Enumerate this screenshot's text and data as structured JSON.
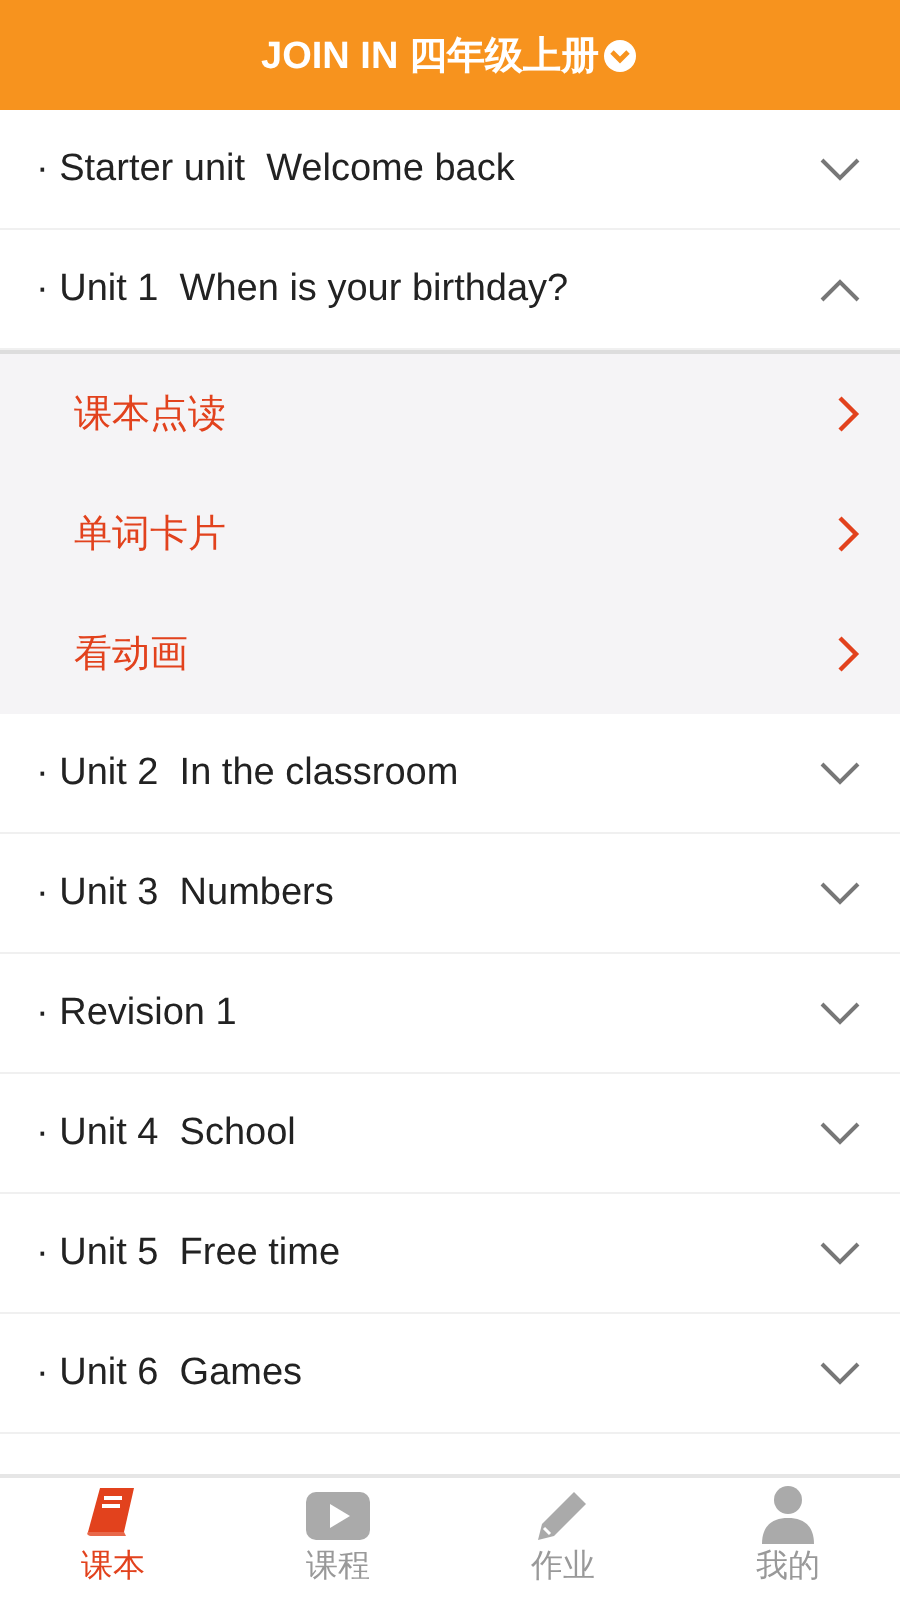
{
  "header": {
    "title": "JOIN IN 四年级上册"
  },
  "units": [
    {
      "title": "· Starter unit  Welcome back",
      "expanded": false
    },
    {
      "title": "· Unit 1  When is your birthday?",
      "expanded": true,
      "children": [
        {
          "label": "课本点读"
        },
        {
          "label": "单词卡片"
        },
        {
          "label": "看动画"
        }
      ]
    },
    {
      "title": "· Unit 2  In the classroom",
      "expanded": false
    },
    {
      "title": "· Unit 3  Numbers",
      "expanded": false
    },
    {
      "title": "· Revision 1",
      "expanded": false
    },
    {
      "title": "· Unit 4  School",
      "expanded": false
    },
    {
      "title": "· Unit 5  Free time",
      "expanded": false
    },
    {
      "title": "· Unit 6  Games",
      "expanded": false
    }
  ],
  "tabs": [
    {
      "label": "课本",
      "kind": "book",
      "selected": true
    },
    {
      "label": "课程",
      "kind": "video",
      "selected": false
    },
    {
      "label": "作业",
      "kind": "pencil",
      "selected": false
    },
    {
      "label": "我的",
      "kind": "person",
      "selected": false
    }
  ]
}
